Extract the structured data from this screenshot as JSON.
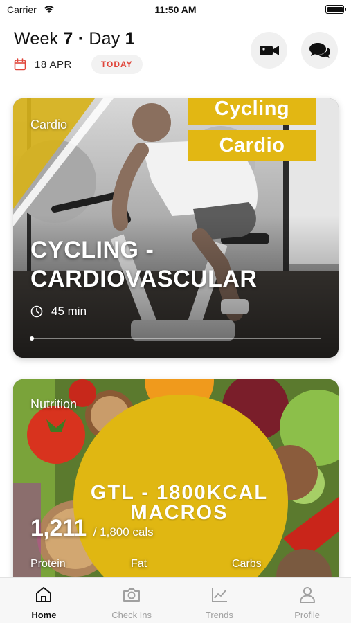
{
  "status_bar": {
    "carrier": "Carrier",
    "time": "11:50 AM"
  },
  "header": {
    "week_label": "Week",
    "week_number": "7",
    "separator": "·",
    "day_label": "Day",
    "day_number": "1",
    "date": "18 APR",
    "today_badge": "TODAY",
    "icons": {
      "calendar": "calendar-icon",
      "video": "video-camera-icon",
      "chat": "chat-bubbles-icon"
    }
  },
  "cards": [
    {
      "category": "Cardio",
      "title_line_1": "CYCLING -",
      "title_line_2": "CARDIOVASCULAR",
      "duration": "45 min",
      "banner_line_1": "Cycling",
      "banner_line_2": "Cardio",
      "slide_position": "1"
    },
    {
      "category": "Nutrition",
      "overlay_title_line_1": "GTL - 1800KCAL",
      "overlay_title_line_2": "MACROS",
      "calories_consumed": "1,211",
      "calories_target": "/ 1,800 cals",
      "macros": [
        "Protein",
        "Fat",
        "Carbs"
      ]
    }
  ],
  "tab_bar": {
    "active": "Home",
    "tabs": [
      {
        "label": "Home",
        "icon": "home-icon"
      },
      {
        "label": "Check Ins",
        "icon": "camera-icon"
      },
      {
        "label": "Trends",
        "icon": "line-chart-icon"
      },
      {
        "label": "Profile",
        "icon": "person-icon"
      }
    ]
  },
  "colors": {
    "accent_yellow": "#e2b713",
    "today_red": "#e0453a",
    "tab_active": "#111111",
    "tab_inactive": "#a0a0a0"
  }
}
